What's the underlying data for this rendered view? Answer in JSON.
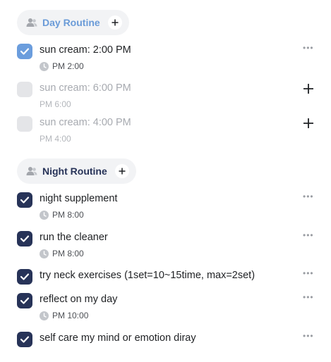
{
  "sections": {
    "day": {
      "title": "Day Routine",
      "title_color": "#6a9bd8",
      "tasks": [
        {
          "title": "sun cream: 2:00 PM",
          "time": "PM 2:00",
          "done": true
        },
        {
          "title": "sun cream: 6:00 PM",
          "time": "PM 6:00",
          "done": false
        },
        {
          "title": "sun cream: 4:00 PM",
          "time": "PM 4:00",
          "done": false
        }
      ]
    },
    "night": {
      "title": "Night Routine",
      "title_color": "#273358",
      "tasks": [
        {
          "title": "night supplement",
          "time": "PM 8:00",
          "done": true
        },
        {
          "title": "run the cleaner",
          "time": "PM 8:00",
          "done": true
        },
        {
          "title": "try neck exercises (1set=10~15time, max=2set)",
          "done": true
        },
        {
          "title": "reflect on my day",
          "time": "PM 10:00",
          "done": true
        },
        {
          "title": "self care my mind or emotion diray",
          "done": true
        }
      ]
    }
  },
  "colors": {
    "day_check": "#6b9ddd",
    "night_check": "#273358",
    "empty_check": "#e4e5e8",
    "chip_bg": "#f2f3f5"
  },
  "icons": {
    "section": "people-icon",
    "add": "plus-icon",
    "time": "clock-icon",
    "menu": "more-icon",
    "check": "check-icon"
  }
}
